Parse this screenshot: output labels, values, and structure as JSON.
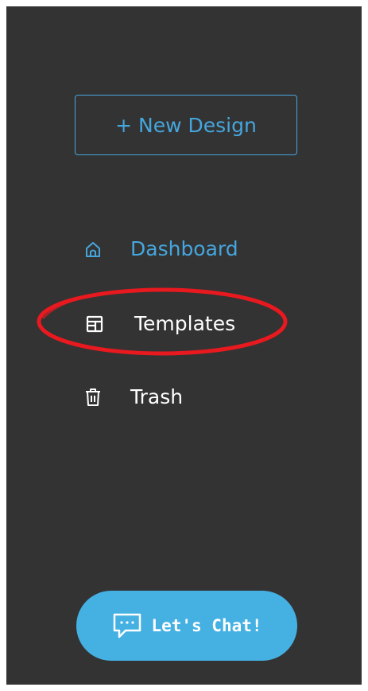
{
  "sidebar": {
    "new_design_label": "+ New Design",
    "nav": {
      "dashboard": {
        "label": "Dashboard",
        "icon": "home-icon",
        "active": true
      },
      "templates": {
        "label": "Templates",
        "icon": "templates-icon",
        "highlighted": true
      },
      "trash": {
        "label": "Trash",
        "icon": "trash-icon"
      }
    },
    "chat": {
      "label": "Let's Chat!",
      "icon": "chat-bubble-icon"
    }
  },
  "colors": {
    "background": "#333333",
    "accent": "#45a6de",
    "chat_button": "#45b1e3",
    "highlight": "#e8191f",
    "text": "#ffffff"
  }
}
